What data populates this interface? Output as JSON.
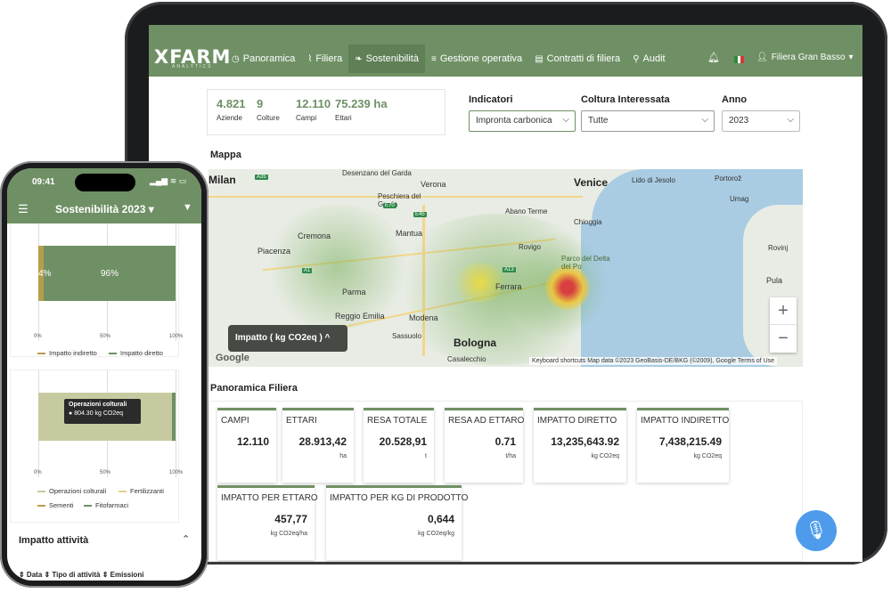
{
  "tablet": {
    "logo": "XFARM",
    "logo_sub": "ANALYTICS",
    "nav": [
      {
        "label": "Panoramica",
        "icon": "◷"
      },
      {
        "label": "Filiera",
        "icon": "⌇"
      },
      {
        "label": "Sostenibilità",
        "icon": "❧"
      },
      {
        "label": "Gestione operativa",
        "icon": "≡"
      },
      {
        "label": "Contratti di filiera",
        "icon": "▤"
      },
      {
        "label": "Audit",
        "icon": "⚲"
      }
    ],
    "user": "Filiera Gran Basso",
    "stats": [
      {
        "value": "4.821",
        "label": "Aziende"
      },
      {
        "value": "9",
        "label": "Colture"
      },
      {
        "value": "12.110",
        "label": "Campi"
      },
      {
        "value": "75.239 ha",
        "label": "Ettari"
      }
    ],
    "filters": {
      "indicatori": {
        "label": "Indicatori",
        "value": "Impronta carbonica"
      },
      "coltura": {
        "label": "Coltura Interessata",
        "value": "Tutte"
      },
      "anno": {
        "label": "Anno",
        "value": "2023"
      }
    },
    "map_title": "Mappa",
    "map": {
      "legend": "Impatto ( kg CO2eq ) ^",
      "cities": [
        "Milan",
        "Desenzano del Garda",
        "Verona",
        "Venice",
        "Lido di Jesolo",
        "Portorož",
        "Peschiera del Garda",
        "Abano Terme",
        "Umag",
        "Cremona",
        "Mantua",
        "Chioggia",
        "Piacenza",
        "Rovigo",
        "Parco del Delta del Po",
        "Rovinj",
        "Parma",
        "Ferrara",
        "Pula",
        "Reggio Emilia",
        "Modena",
        "Sassuolo",
        "Bologna",
        "Casalecchio"
      ],
      "attribution": "Keyboard shortcuts   Map data ©2023 GeoBasis-DE/BKG (©2009), Google   Terms of Use",
      "google": "Google"
    },
    "panoramica_title": "Panoramica Filiera",
    "cards": [
      {
        "title": "CAMPI",
        "value": "12.110",
        "unit": ""
      },
      {
        "title": "ETTARI",
        "value": "28.913,42",
        "unit": "ha"
      },
      {
        "title": "RESA TOTALE",
        "value": "20.528,91",
        "unit": "t"
      },
      {
        "title": "RESA AD ETTARO",
        "value": "0.71",
        "unit": "t/ha"
      },
      {
        "title": "IMPATTO DIRETTO",
        "value": "13,235,643.92",
        "unit": "kg CO2eq"
      },
      {
        "title": "IMPATTO INDIRETTO",
        "value": "7,438,215.49",
        "unit": "kg CO2eq"
      },
      {
        "title": "IMPATTO PER ETTARO",
        "value": "457,77",
        "unit": "kg CO2eq/ha"
      },
      {
        "title": "IMPATTO PER KG DI PRODOTTO",
        "value": "0,644",
        "unit": "kg CO2eq/kg"
      }
    ]
  },
  "phone": {
    "time": "09:41",
    "signal": "▂▄▆ ≋ ▭",
    "title": "Sostenibilità 2023 ▾",
    "bar1": {
      "left_pct": "4%",
      "right_pct": "96%",
      "left_share": 0.04
    },
    "ticks": [
      "0%",
      "50%",
      "100%"
    ],
    "legend1": [
      "Impatto indiretto",
      "Impatto diretto"
    ],
    "tooltip": {
      "title": "Operazioni colturali",
      "value": "804.30 kg CO2eq"
    },
    "legend2": [
      "Operazioni colturali",
      "Fertilizzanti",
      "Sementi",
      "Fitofarmaci"
    ],
    "section": "Impatto attività",
    "columns": "⇕ Data      ⇕ Tipo di attività  ⇕ Emissioni"
  },
  "colors": {
    "brand": "#6f9065",
    "brand_dark": "#5f7f56",
    "accent_blue": "#4d9bea"
  }
}
